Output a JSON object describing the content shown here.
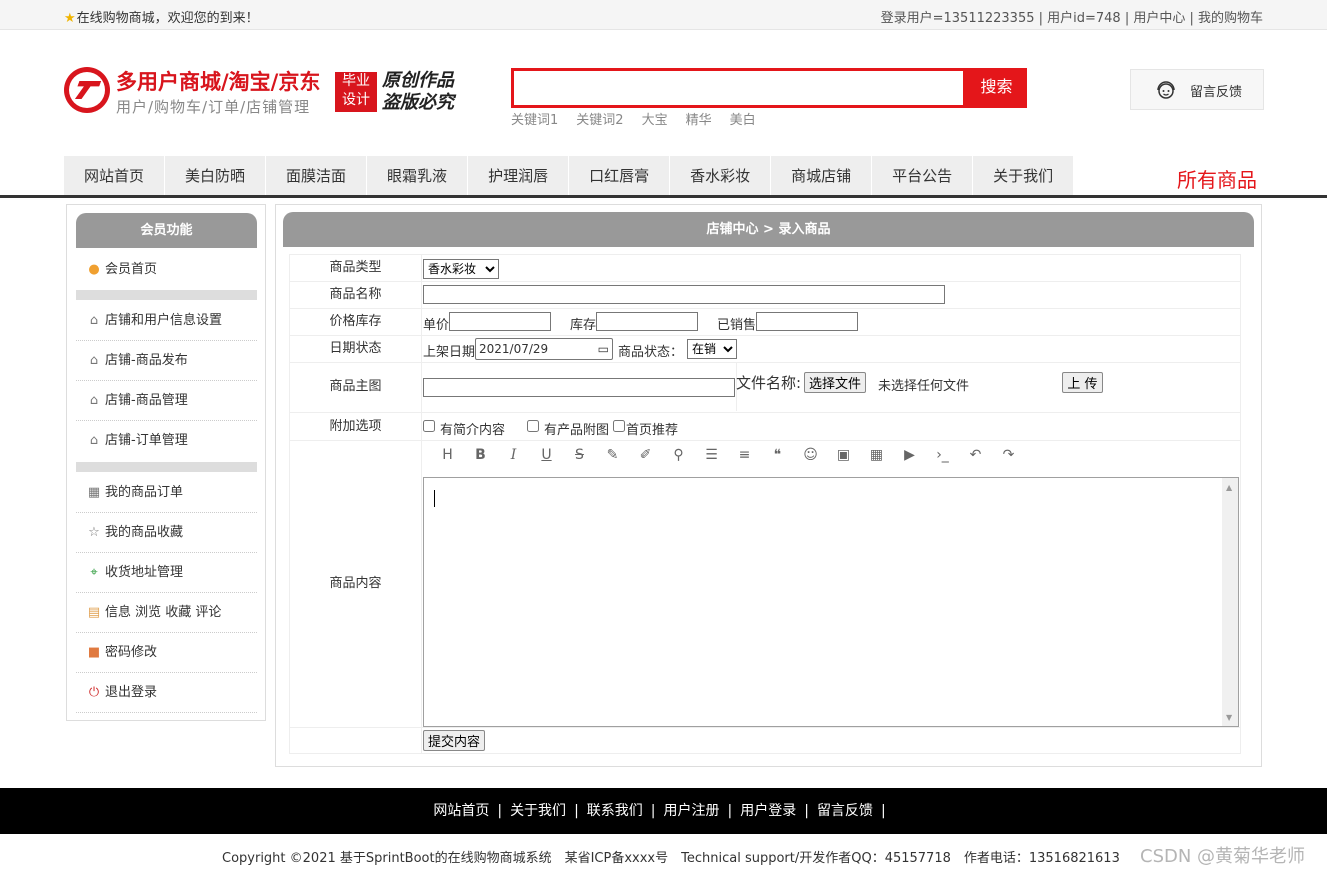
{
  "topbar": {
    "welcome": "在线购物商城，欢迎您的到来！",
    "user_info": "登录用户=13511223355 | 用户id=748 | 用户中心 | 我的购物车"
  },
  "header": {
    "title": "多用户商城/淘宝/京东",
    "subtitle": "用户/购物车/订单/店铺管理",
    "badge_line1": "毕业",
    "badge_line2": "设计",
    "motto_line1": "原创作品",
    "motto_line2": "盗版必究",
    "search_value": "",
    "search_button": "搜索",
    "keywords": [
      "关键词1",
      "关键词2",
      "大宝",
      "精华",
      "美白"
    ],
    "feedback": "留言反馈"
  },
  "nav": {
    "items": [
      "网站首页",
      "美白防晒",
      "面膜洁面",
      "眼霜乳液",
      "护理润唇",
      "口红唇膏",
      "香水彩妆",
      "商城店铺",
      "平台公告",
      "关于我们"
    ],
    "all_goods": "所有商品"
  },
  "sidebar": {
    "title": "会员功能",
    "home": "会员首页",
    "group1": [
      "店铺和用户信息设置",
      "店铺-商品发布",
      "店铺-商品管理",
      "店铺-订单管理"
    ],
    "group2": [
      "我的商品订单",
      "我的商品收藏",
      "收货地址管理",
      "信息 浏览 收藏 评论",
      "密码修改",
      "退出登录"
    ]
  },
  "main": {
    "breadcrumb": "店铺中心 > 录入商品",
    "form": {
      "type_label": "商品类型",
      "type_value": "香水彩妆",
      "name_label": "商品名称",
      "name_value": "",
      "price_label": "价格库存",
      "unit_price": "单价",
      "stock": "库存",
      "sold": "已销售",
      "date_label": "日期状态",
      "shelf_date_label": "上架日期",
      "shelf_date_value": "2021/07/29",
      "status_label": "商品状态：",
      "status_value": "在销",
      "image_label": "商品主图",
      "file_name_label": "文件名称:",
      "choose_file": "选择文件",
      "no_file": "未选择任何文件",
      "upload": "上 传",
      "options_label": "附加选项",
      "opt_intro": "有简介内容",
      "opt_product_img": "有产品附图",
      "opt_home": "首页推荐",
      "content_label": "商品内容",
      "submit": "提交内容"
    }
  },
  "footer": {
    "links": [
      "网站首页",
      "关于我们",
      "联系我们",
      "用户注册",
      "用户登录",
      "留言反馈"
    ],
    "copyright": "Copyright ©2021 基于SprintBoot的在线购物商城系统　某省ICP备xxxx号　Technical support/开发作者QQ：45157718　作者电话：13516821613",
    "watermark": "CSDN @黄菊华老师"
  }
}
